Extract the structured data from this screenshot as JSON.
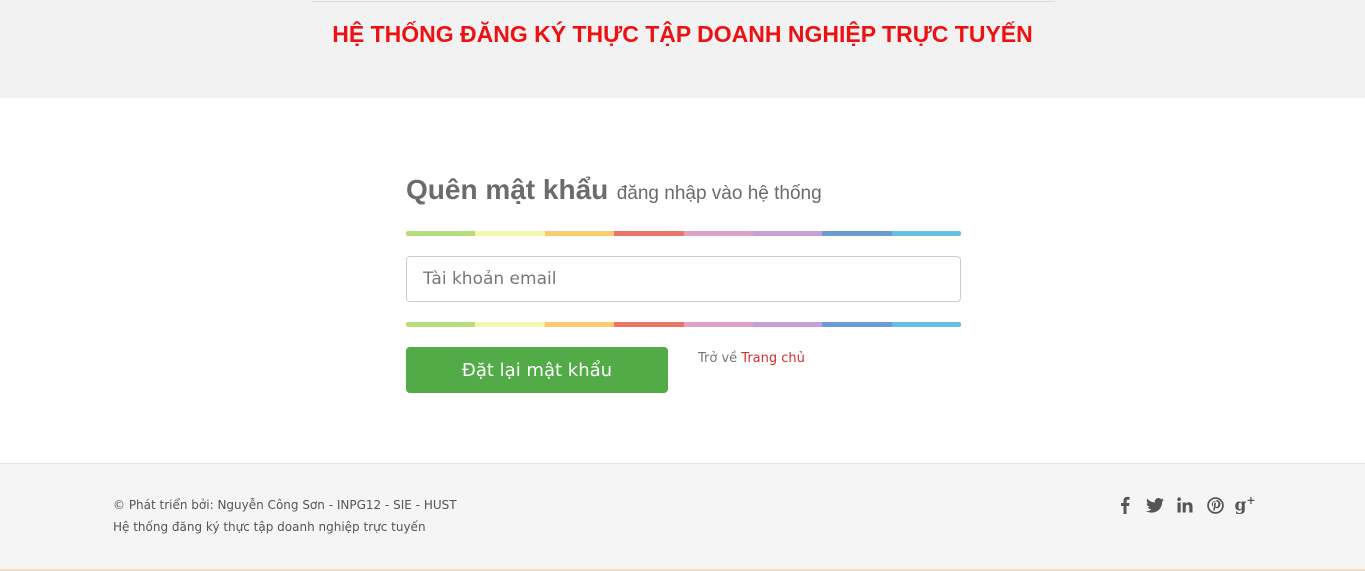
{
  "header": {
    "title": "HỆ THỐNG ĐĂNG KÝ THỰC TẬP DOANH NGHIỆP TRỰC TUYẾN"
  },
  "form": {
    "heading": "Quên mật khẩu",
    "subheading": "đăng nhập vào hệ thống",
    "email_placeholder": "Tài khoản email",
    "email_value": "",
    "submit_label": "Đặt lại mật khẩu",
    "back_prefix": "Trở về",
    "back_link": "Trang chủ"
  },
  "rainbow_colors": [
    "#b7dc7a",
    "#f2f7b1",
    "#fccb6e",
    "#ec7467",
    "#dda2c7",
    "#c79ed6",
    "#6b9bd6",
    "#67c0e4"
  ],
  "footer": {
    "copyright": "© Phát triển bởi: Nguyễn Công Sơn - INPG12 - SIE - HUST",
    "tagline": "Hệ thống đăng ký thực tập doanh nghiệp trực tuyến",
    "social_icons": [
      "facebook-icon",
      "twitter-icon",
      "linkedin-icon",
      "pinterest-icon",
      "google-plus-icon"
    ]
  },
  "colors": {
    "title_red": "#ee1111",
    "button_green": "#52ab47",
    "link_red": "#d42d2d"
  }
}
